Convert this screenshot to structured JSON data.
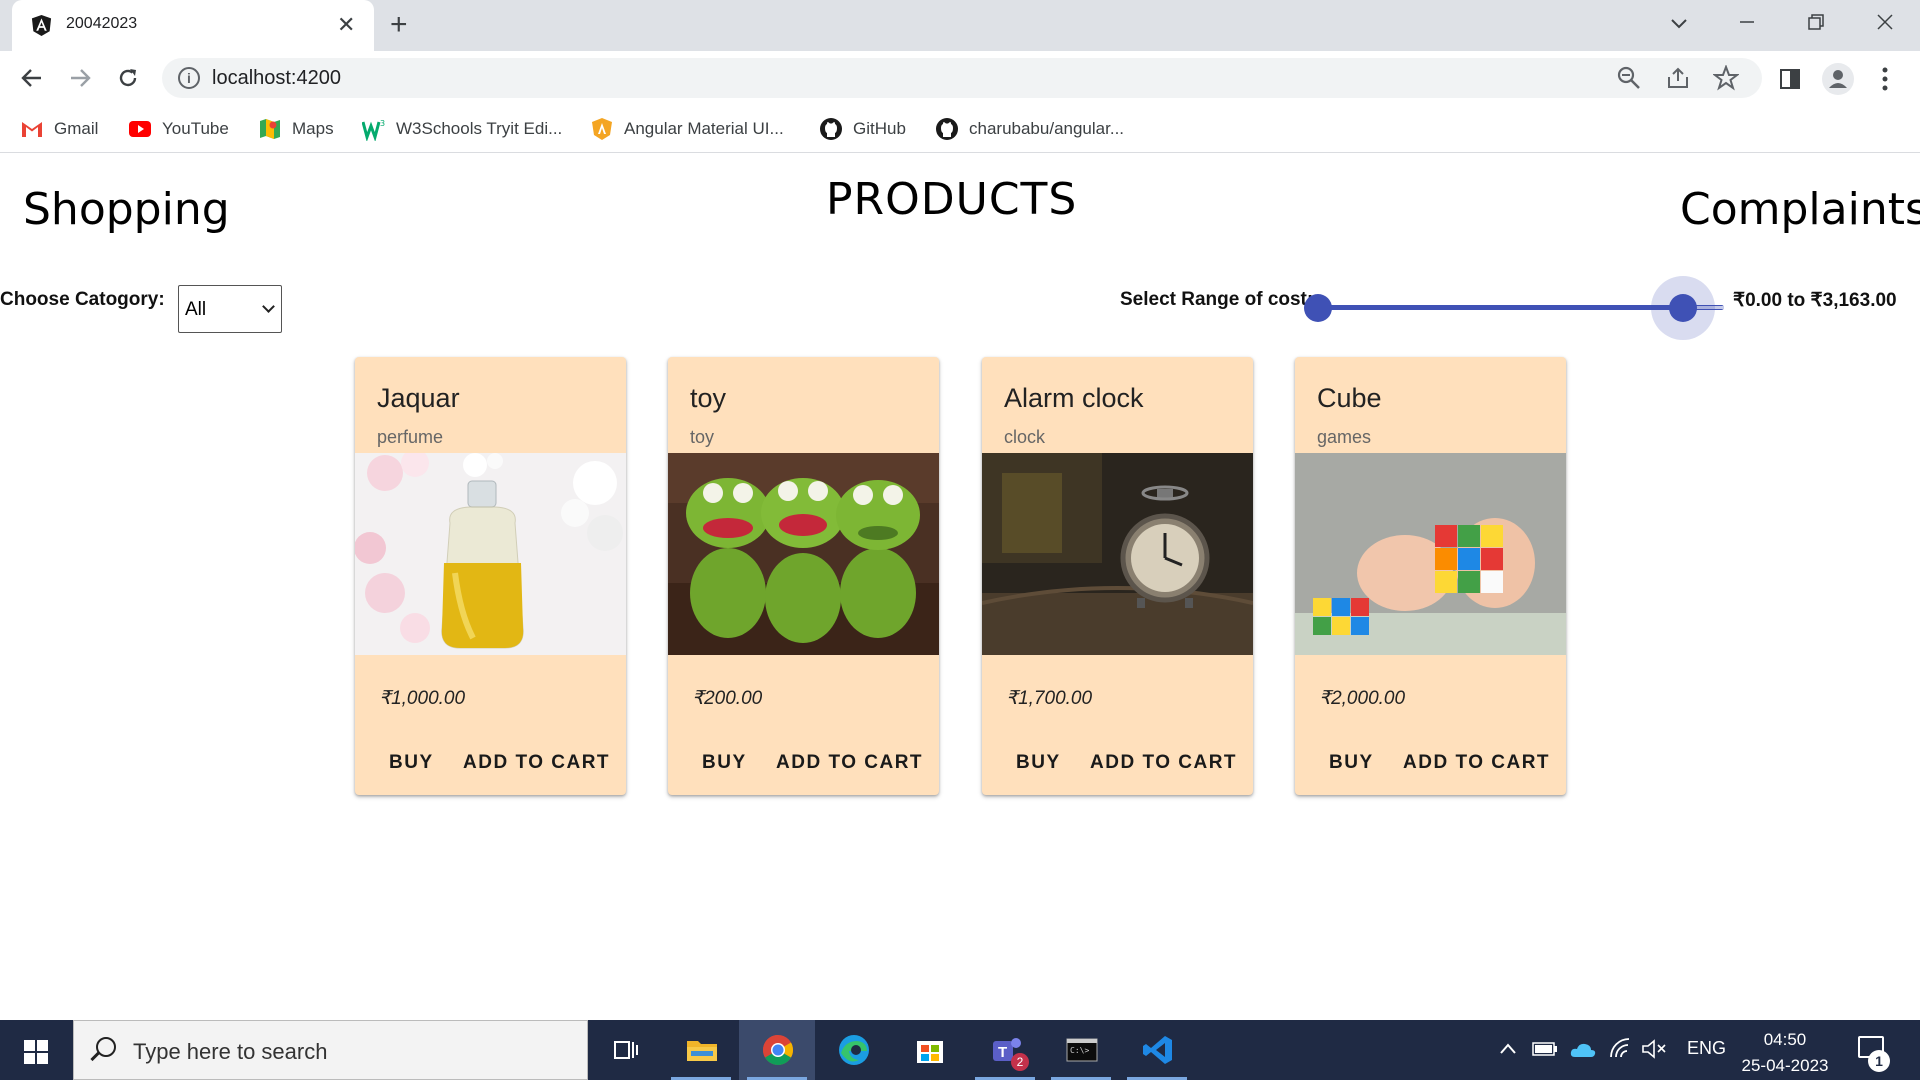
{
  "browser": {
    "tab_title": "20042023",
    "tab_close": "✕",
    "new_tab": "+",
    "url": "localhost:4200",
    "bookmarks": [
      "Gmail",
      "YouTube",
      "Maps",
      "W3Schools Tryit Edi...",
      "Angular Material UI...",
      "GitHub",
      "charubabu/angular..."
    ]
  },
  "page": {
    "left_title": "Shopping",
    "center_title": "PRODUCTS",
    "right_title": "Complaints",
    "category_label": "Choose Catogory:",
    "category_value": "All",
    "range_label": "Select Range of cost:",
    "range_text": "₹0.00 to ₹3,163.00",
    "accent_color": "#3f51b5",
    "card_color": "#ffe0bc"
  },
  "products": [
    {
      "title": "Jaquar",
      "subtitle": "perfume",
      "price": "₹1,000.00",
      "buy": "BUY",
      "cart": "ADD TO CART"
    },
    {
      "title": "toy",
      "subtitle": "toy",
      "price": "₹200.00",
      "buy": "BUY",
      "cart": "ADD TO CART"
    },
    {
      "title": "Alarm clock",
      "subtitle": "clock",
      "price": "₹1,700.00",
      "buy": "BUY",
      "cart": "ADD TO CART"
    },
    {
      "title": "Cube",
      "subtitle": "games",
      "price": "₹2,000.00",
      "buy": "BUY",
      "cart": "ADD TO CART"
    }
  ],
  "taskbar": {
    "search_placeholder": "Type here to search",
    "language": "ENG",
    "time": "04:50",
    "date": "25-04-2023",
    "notification_count": "1",
    "teams_badge": "2"
  }
}
